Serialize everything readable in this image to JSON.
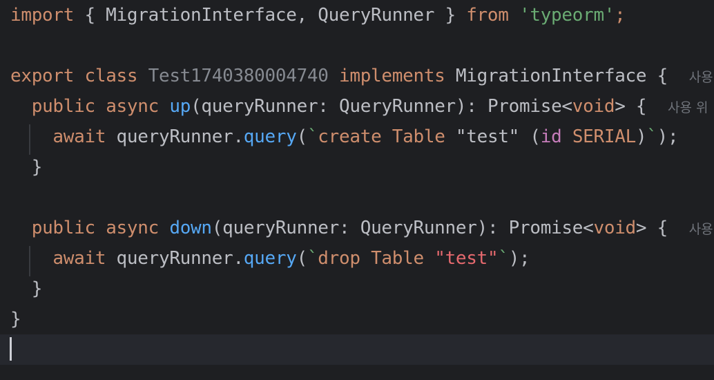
{
  "editor": {
    "language": "typescript",
    "colors": {
      "background": "#1e1f22",
      "current_line": "#26282e",
      "keyword": "#cf8e6d",
      "string": "#6aab73",
      "function": "#56a8f5",
      "text": "#bcbec4",
      "field": "#c77dbb",
      "sql_string": "#e5696e",
      "hint": "#6f737a"
    },
    "lines": [
      [
        {
          "t": "import",
          "c": "kw"
        },
        {
          "t": " { MigrationInterface, QueryRunner } ",
          "c": "plain"
        },
        {
          "t": "from",
          "c": "kw"
        },
        {
          "t": " ",
          "c": "plain"
        },
        {
          "t": "'typeorm'",
          "c": "str"
        },
        {
          "t": ";",
          "c": "kw"
        }
      ],
      [],
      [
        {
          "t": "export",
          "c": "kw"
        },
        {
          "t": " ",
          "c": "plain"
        },
        {
          "t": "class",
          "c": "kw"
        },
        {
          "t": " ",
          "c": "plain"
        },
        {
          "t": "Test1740380004740",
          "c": "dim"
        },
        {
          "t": " ",
          "c": "plain"
        },
        {
          "t": "implements",
          "c": "kw"
        },
        {
          "t": " MigrationInterface {  ",
          "c": "plain"
        },
        {
          "t": "사용",
          "c": "hint"
        }
      ],
      [
        {
          "t": "  ",
          "c": "plain"
        },
        {
          "t": "public",
          "c": "kw"
        },
        {
          "t": " ",
          "c": "plain"
        },
        {
          "t": "async",
          "c": "kw"
        },
        {
          "t": " ",
          "c": "plain"
        },
        {
          "t": "up",
          "c": "fn"
        },
        {
          "t": "(queryRunner: QueryRunner): Promise<",
          "c": "plain"
        },
        {
          "t": "void",
          "c": "kw"
        },
        {
          "t": "> {  ",
          "c": "plain"
        },
        {
          "t": "사용 위",
          "c": "hint"
        }
      ],
      [
        {
          "t": "    ",
          "c": "plain"
        },
        {
          "t": "await",
          "c": "kw"
        },
        {
          "t": " queryRunner.",
          "c": "plain"
        },
        {
          "t": "query",
          "c": "fn"
        },
        {
          "t": "(",
          "c": "plain"
        },
        {
          "t": "`",
          "c": "str"
        },
        {
          "t": "create",
          "c": "sql-kw"
        },
        {
          "t": " ",
          "c": "plain"
        },
        {
          "t": "Table",
          "c": "sql-kw"
        },
        {
          "t": " \"test\" (",
          "c": "sql-str"
        },
        {
          "t": "id",
          "c": "sql-field"
        },
        {
          "t": " ",
          "c": "plain"
        },
        {
          "t": "SERIAL",
          "c": "sql-type"
        },
        {
          "t": ")",
          "c": "plain"
        },
        {
          "t": "`",
          "c": "str"
        },
        {
          "t": ");",
          "c": "plain"
        }
      ],
      [
        {
          "t": "  }",
          "c": "plain"
        }
      ],
      [],
      [
        {
          "t": "  ",
          "c": "plain"
        },
        {
          "t": "public",
          "c": "kw"
        },
        {
          "t": " ",
          "c": "plain"
        },
        {
          "t": "async",
          "c": "kw"
        },
        {
          "t": " ",
          "c": "plain"
        },
        {
          "t": "down",
          "c": "fn"
        },
        {
          "t": "(queryRunner: QueryRunner): Promise<",
          "c": "plain"
        },
        {
          "t": "void",
          "c": "kw"
        },
        {
          "t": "> {  ",
          "c": "plain"
        },
        {
          "t": "사용",
          "c": "hint"
        }
      ],
      [
        {
          "t": "    ",
          "c": "plain"
        },
        {
          "t": "await",
          "c": "kw"
        },
        {
          "t": " queryRunner.",
          "c": "plain"
        },
        {
          "t": "query",
          "c": "fn"
        },
        {
          "t": "(",
          "c": "plain"
        },
        {
          "t": "`",
          "c": "str"
        },
        {
          "t": "drop",
          "c": "sql-kw"
        },
        {
          "t": " ",
          "c": "plain"
        },
        {
          "t": "Table",
          "c": "sql-kw"
        },
        {
          "t": " ",
          "c": "plain"
        },
        {
          "t": "\"test\"",
          "c": "sql-str-red"
        },
        {
          "t": "`",
          "c": "str"
        },
        {
          "t": ");",
          "c": "plain"
        }
      ],
      [
        {
          "t": "  }",
          "c": "plain"
        }
      ],
      [
        {
          "t": "}",
          "c": "plain"
        }
      ],
      []
    ]
  }
}
